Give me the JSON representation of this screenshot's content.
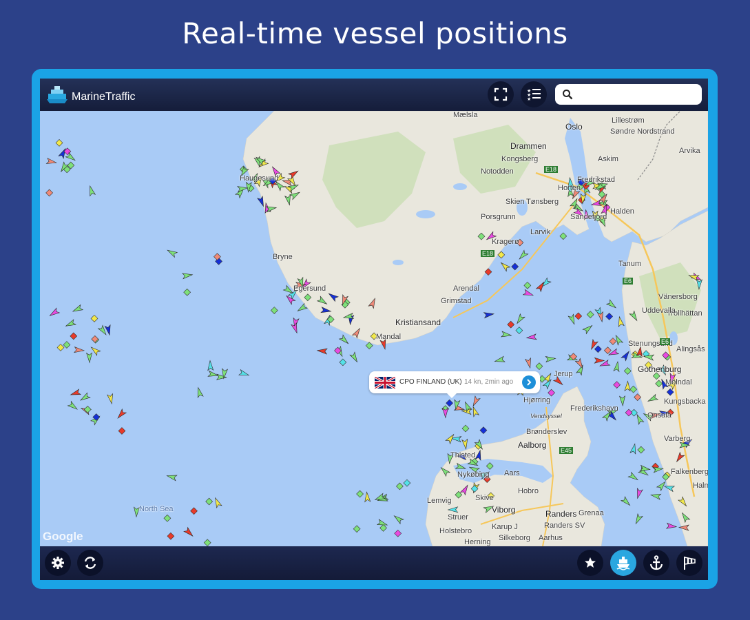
{
  "promo": {
    "title": "Real-time vessel positions"
  },
  "app": {
    "name": "MarineTraffic"
  },
  "search": {
    "placeholder": "",
    "value": ""
  },
  "map": {
    "place_labels": [
      "Mælsla",
      "Lillestrøm",
      "Oslo",
      "Søndre Nordstrand",
      "Drammen",
      "Kongsberg",
      "Arvika",
      "Askim",
      "Notodden",
      "Haugesund",
      "Horten",
      "Fredrikstad",
      "Skien",
      "Tønsberg",
      "Sandefjord",
      "Halden",
      "Porsgrunn",
      "Larvik",
      "Kragerø",
      "Bryne",
      "Tanum",
      "Egersund",
      "Arendal",
      "Grimstad",
      "Vänersborg",
      "Trollhättan",
      "Kristiansand",
      "Mandal",
      "Uddevalla",
      "Stenungsund",
      "Alingsås",
      "Gothenburg",
      "Mölndal",
      "Jerup",
      "Hjørring",
      "Frederikshavn",
      "Kungsbacka",
      "Vendsyssel",
      "Onsala",
      "Brønderslev",
      "Varberg",
      "Aalborg",
      "Thisted",
      "Falkenberg",
      "Nykøbing",
      "Aars",
      "Hobro",
      "Halm",
      "North Sea",
      "Lemvig",
      "Skive",
      "Viborg",
      "Randers",
      "Grenaa",
      "Struer",
      "Holstebro",
      "Karup J",
      "Randers SV",
      "Silkeborg",
      "Aarhus",
      "Herning"
    ],
    "road_labels": [
      "E18",
      "E18",
      "E6",
      "E6",
      "E45"
    ],
    "attribution": "Google"
  },
  "popup": {
    "vessel": "CPO FINLAND (UK)",
    "info": "14 kn, 2min ago",
    "flag": "uk-flag-icon"
  },
  "topbar": {
    "icons": [
      "fullscreen-icon",
      "filter-list-icon",
      "search-icon"
    ]
  },
  "bottombar": {
    "icons": [
      "settings-icon",
      "refresh-icon",
      "star-icon",
      "ship-icon",
      "anchor-icon",
      "windsock-icon"
    ],
    "active": "ship-icon"
  },
  "colors": {
    "background": "#2c4189",
    "frame": "#1aa3e6",
    "sea": "#a9cbf6",
    "land": "#e8e6dc",
    "accent": "#2aa7e0"
  }
}
